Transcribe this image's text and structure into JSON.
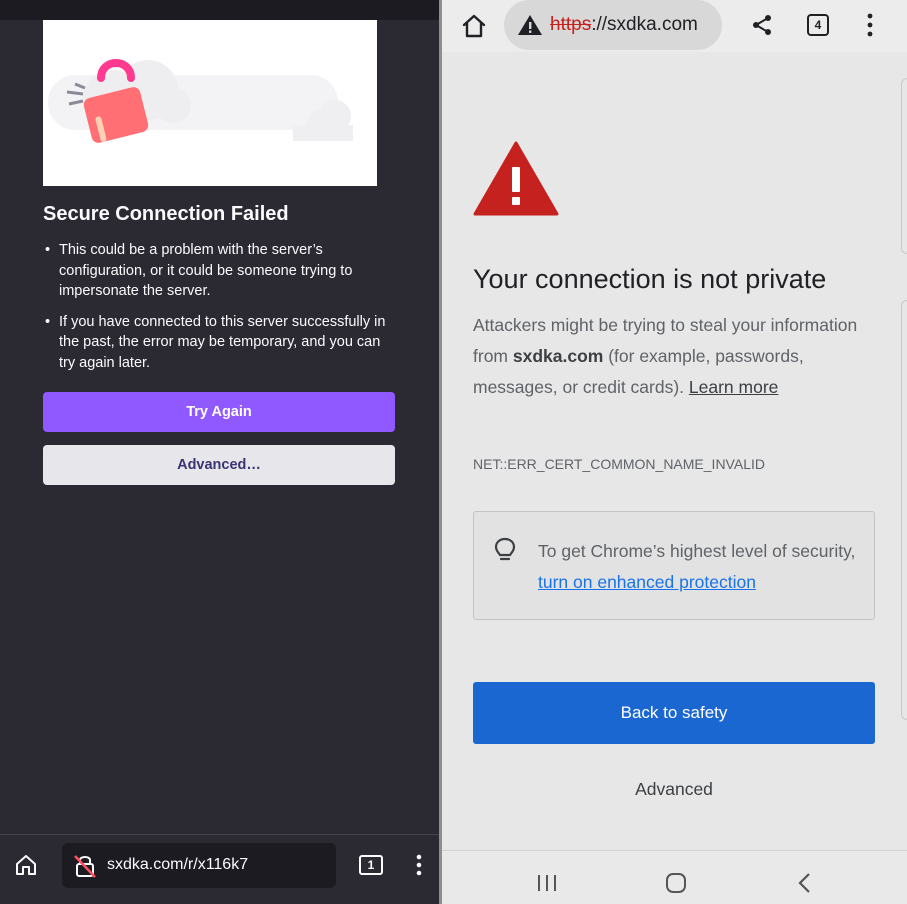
{
  "left": {
    "title": "Secure Connection Failed",
    "bullets": [
      "This could be a problem with the server’s configuration, or it could be someone trying to impersonate the server.",
      "If you have connected to this server successfully in the past, the error may be temporary, and you can try again later."
    ],
    "try_again_label": "Try Again",
    "advanced_label": "Advanced…",
    "url": "sxdka.com/r/x116k7",
    "tab_count": "1",
    "icons": [
      "home-icon",
      "insecure-lock-icon",
      "tabs-icon",
      "overflow-menu-icon",
      "broken-padlock-illustration"
    ],
    "colors": {
      "background": "#2b2a33",
      "primary_button": "#9059ff",
      "secondary_button": "#e6e6eb"
    }
  },
  "right": {
    "address": {
      "scheme": "https",
      "rest": "://sxdka.com"
    },
    "tab_count": "4",
    "heading": "Your connection is not private",
    "desc_before": "Attackers might be trying to steal your information from ",
    "desc_domain": "sxdka.com",
    "desc_after": " (for example, passwords, messages, or credit cards). ",
    "learn_more": "Learn more",
    "error_code": "NET::ERR_CERT_COMMON_NAME_INVALID",
    "security_text": "To get Chrome’s highest level of security, ",
    "security_link": "turn on enhanced protection",
    "back_label": "Back to safety",
    "advanced_label": "Advanced",
    "icons": [
      "home-icon",
      "warning-icon",
      "share-icon",
      "tabs-icon",
      "overflow-menu-icon",
      "warning-triangle-icon",
      "lightbulb-icon",
      "recents-nav-icon",
      "home-nav-icon",
      "back-nav-icon"
    ],
    "colors": {
      "background": "#e7e7e7",
      "primary_button": "#1a67d2",
      "warning": "#c5221f",
      "link": "#1a73e8"
    }
  }
}
